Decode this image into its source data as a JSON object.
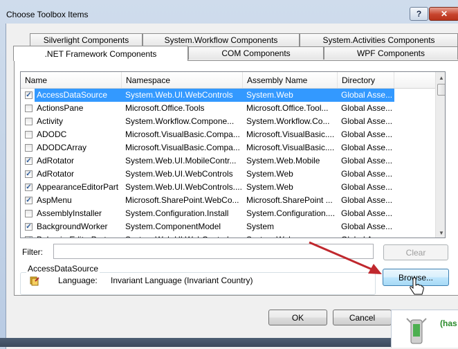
{
  "window": {
    "title": "Choose Toolbox Items",
    "help_glyph": "?",
    "close_glyph": "✕"
  },
  "tabs": {
    "row_back": [
      "Silverlight Components",
      "System.Workflow Components",
      "System.Activities Components"
    ],
    "row_front": [
      ".NET Framework Components",
      "COM Components",
      "WPF Components"
    ]
  },
  "columns": [
    "Name",
    "Namespace",
    "Assembly Name",
    "Directory"
  ],
  "rows": [
    {
      "checked": true,
      "name": "AccessDataSource",
      "ns": "System.Web.UI.WebControls",
      "asm": "System.Web",
      "dir": "Global Asse..."
    },
    {
      "checked": false,
      "name": "ActionsPane",
      "ns": "Microsoft.Office.Tools",
      "asm": "Microsoft.Office.Tool...",
      "dir": "Global Asse..."
    },
    {
      "checked": false,
      "name": "Activity",
      "ns": "System.Workflow.Compone...",
      "asm": "System.Workflow.Co...",
      "dir": "Global Asse..."
    },
    {
      "checked": false,
      "name": "ADODC",
      "ns": "Microsoft.VisualBasic.Compa...",
      "asm": "Microsoft.VisualBasic....",
      "dir": "Global Asse..."
    },
    {
      "checked": false,
      "name": "ADODCArray",
      "ns": "Microsoft.VisualBasic.Compa...",
      "asm": "Microsoft.VisualBasic....",
      "dir": "Global Asse..."
    },
    {
      "checked": true,
      "name": "AdRotator",
      "ns": "System.Web.UI.MobileContr...",
      "asm": "System.Web.Mobile",
      "dir": "Global Asse..."
    },
    {
      "checked": true,
      "name": "AdRotator",
      "ns": "System.Web.UI.WebControls",
      "asm": "System.Web",
      "dir": "Global Asse..."
    },
    {
      "checked": true,
      "name": "AppearanceEditorPart",
      "ns": "System.Web.UI.WebControls....",
      "asm": "System.Web",
      "dir": "Global Asse..."
    },
    {
      "checked": true,
      "name": "AspMenu",
      "ns": "Microsoft.SharePoint.WebCo...",
      "asm": "Microsoft.SharePoint ...",
      "dir": "Global Asse..."
    },
    {
      "checked": false,
      "name": "AssemblyInstaller",
      "ns": "System.Configuration.Install",
      "asm": "System.Configuration....",
      "dir": "Global Asse..."
    },
    {
      "checked": true,
      "name": "BackgroundWorker",
      "ns": "System.ComponentModel",
      "asm": "System",
      "dir": "Global Asse..."
    },
    {
      "checked": true,
      "name": "BehaviorEditorPart",
      "ns": "System.Web.UI.WebControls",
      "asm": "System.Web",
      "dir": "Global Asse..."
    }
  ],
  "filter": {
    "label": "Filter:",
    "value": "",
    "clear_label": "Clear"
  },
  "info": {
    "group_title": "AccessDataSource",
    "language_label": "Language:",
    "language_value": "Invariant Language (Invariant Country)"
  },
  "buttons": {
    "browse": "Browse...",
    "ok": "OK",
    "cancel": "Cancel"
  },
  "background_app": {
    "text": "(has"
  },
  "colors": {
    "selection": "#3399ff",
    "arrow": "#c0282e",
    "accent_green": "#2a8a2a"
  }
}
